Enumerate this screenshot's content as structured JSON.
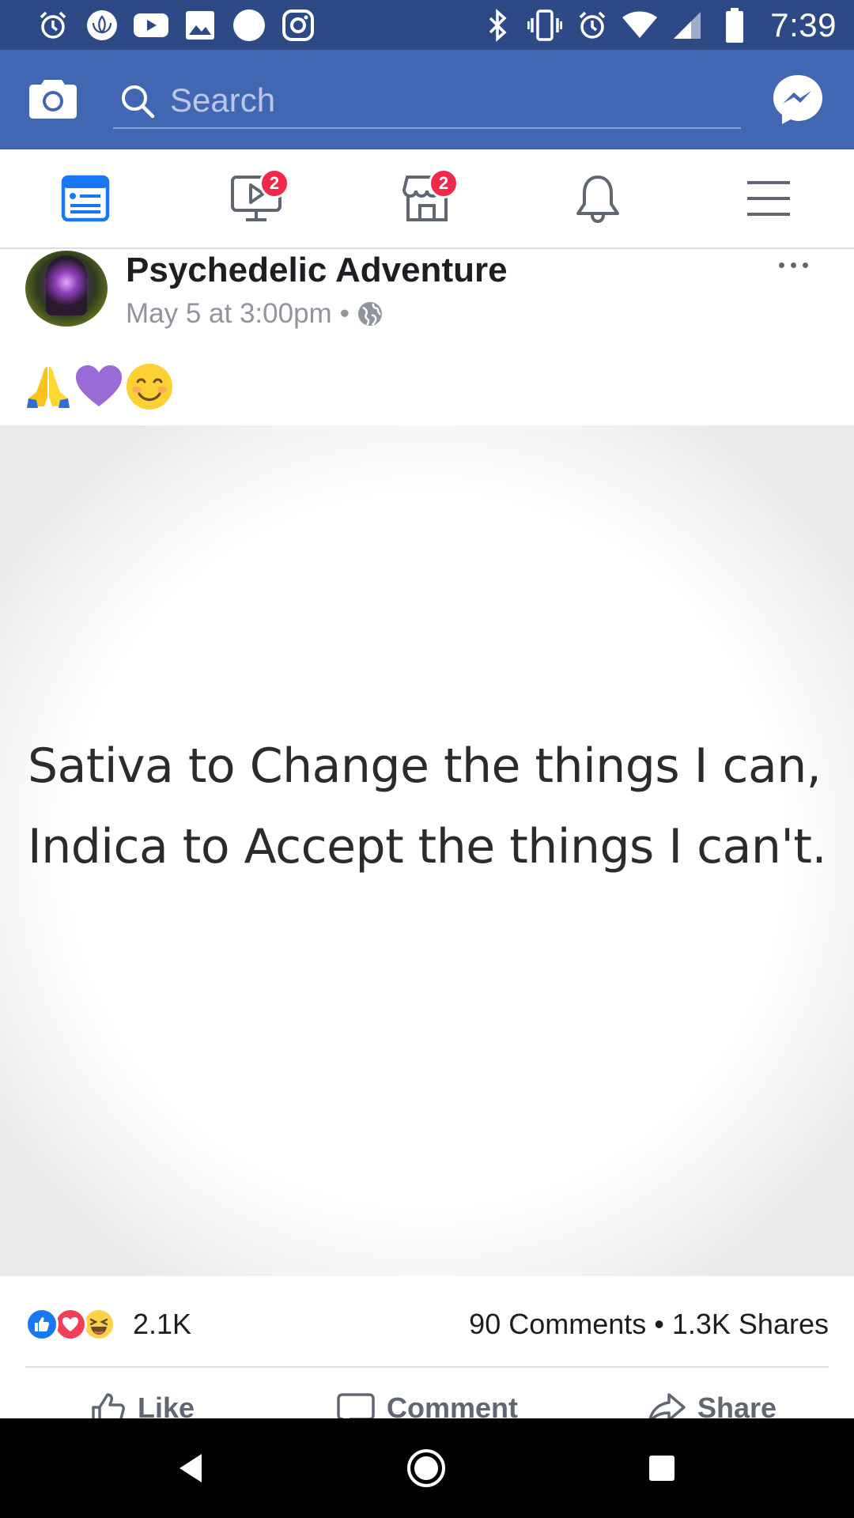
{
  "status_bar": {
    "time": "7:39",
    "left_icons": [
      "alarm-icon",
      "lotus-icon",
      "youtube-icon",
      "photos-icon",
      "circle-icon",
      "instagram-icon"
    ],
    "right_icons": [
      "bluetooth-icon",
      "vibrate-icon",
      "alarm-icon",
      "wifi-icon",
      "signal-icon",
      "battery-icon"
    ]
  },
  "app_bar": {
    "search_placeholder": "Search",
    "background_color": "#4267b2"
  },
  "nav_tabs": [
    {
      "name": "news-feed",
      "icon": "news-feed-icon",
      "active": true
    },
    {
      "name": "watch",
      "icon": "watch-icon",
      "badge": "2"
    },
    {
      "name": "marketplace",
      "icon": "marketplace-icon",
      "badge": "2"
    },
    {
      "name": "notifications",
      "icon": "bell-icon"
    },
    {
      "name": "menu",
      "icon": "hamburger-menu-icon"
    }
  ],
  "post": {
    "page_name": "Psychedelic Adventure",
    "timestamp": "May 5 at 3:00pm",
    "separator": "•",
    "privacy_icon": "globe-icon",
    "emoji_text": "🙏💜😊",
    "image_text": {
      "line1": "Sativa to Change the things I can,",
      "line2": "Indica to Accept the things I can't."
    },
    "reactions": [
      "like",
      "love",
      "haha"
    ],
    "reaction_count": "2.1K",
    "engagement": "90 Comments • 1.3K Shares",
    "actions": {
      "like": "Like",
      "comment": "Comment",
      "share": "Share"
    }
  },
  "colors": {
    "status_bar": "#2e4a86",
    "accent": "#4267b2",
    "badge": "#f02849",
    "like": "#1877f2",
    "love": "#f33e58"
  }
}
